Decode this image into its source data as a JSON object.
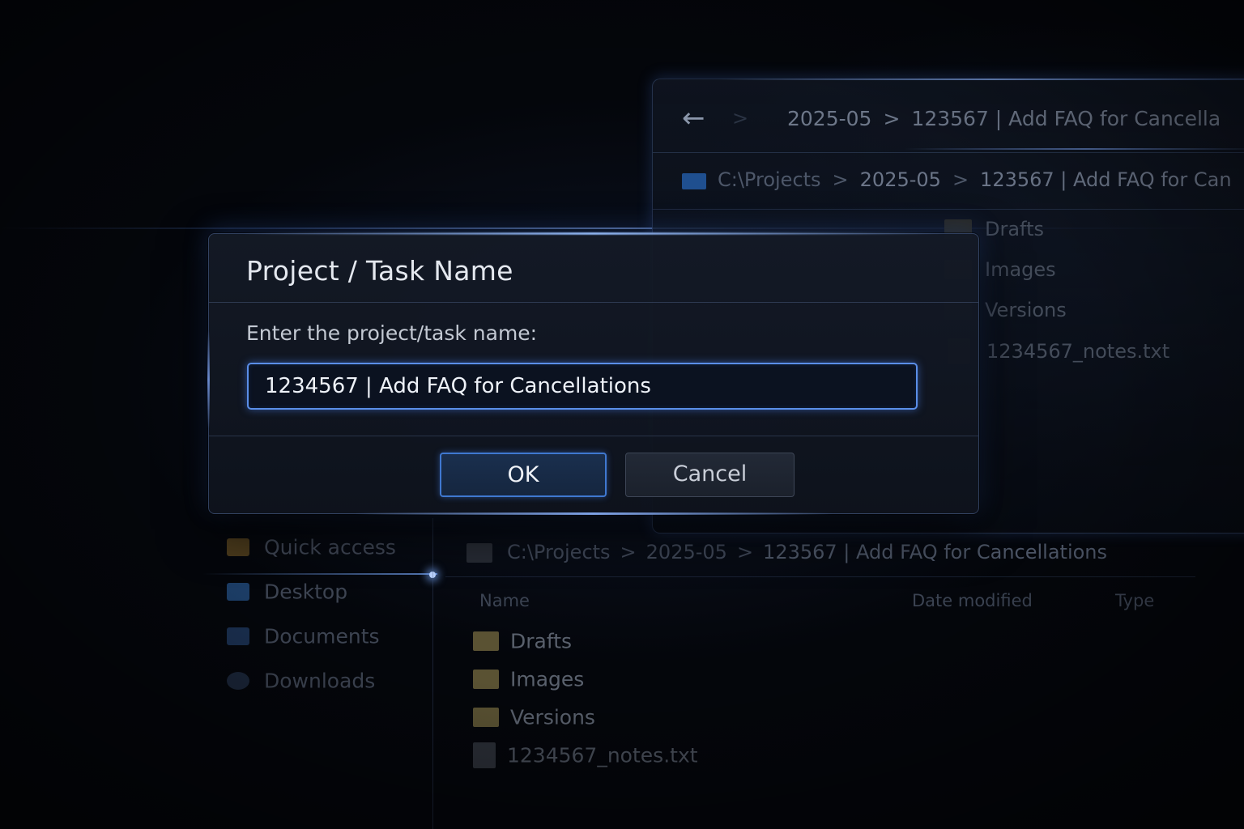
{
  "background_explorer_top": {
    "nav_breadcrumb": [
      "2025-05",
      "123567 | Add FAQ for Cancella"
    ],
    "address_path": [
      "C:\\Projects",
      "2025-05",
      "123567 | Add FAQ for Can"
    ],
    "items": [
      {
        "name": "Drafts",
        "icon": "folder-icon"
      },
      {
        "name": "Images",
        "icon": "folder-icon"
      },
      {
        "name": "Versions",
        "icon": "folder-icon"
      },
      {
        "name": "1234567_notes.txt",
        "icon": "text-file-icon"
      }
    ]
  },
  "background_explorer_bottom": {
    "sidebar": [
      {
        "label": "Quick access",
        "icon": "quick-access-icon",
        "color": "#4a3a1c"
      },
      {
        "label": "Desktop",
        "icon": "desktop-icon",
        "color": "#1c3d66"
      },
      {
        "label": "Documents",
        "icon": "documents-icon",
        "color": "#1a2f4f"
      },
      {
        "label": "Downloads",
        "icon": "downloads-icon",
        "color": "#1a2538"
      }
    ],
    "address_path": [
      "C:\\Projects",
      "2025-05",
      "123567 | Add FAQ for Cancellations"
    ],
    "columns": {
      "name": "Name",
      "date_modified": "Date modified",
      "type": "Type"
    },
    "files": [
      {
        "name": "Drafts",
        "icon": "folder-icon"
      },
      {
        "name": "Images",
        "icon": "folder-icon"
      },
      {
        "name": "Versions",
        "icon": "folder-icon"
      },
      {
        "name": "1234567_notes.txt",
        "icon": "text-file-icon"
      }
    ]
  },
  "dialog": {
    "title": "Project / Task Name",
    "prompt": "Enter the project/task name:",
    "input_value": "1234567 | Add FAQ for Cancellations",
    "ok_label": "OK",
    "cancel_label": "Cancel",
    "accent_color": "#5a8ee8"
  },
  "icons": {
    "back": "←",
    "chevron": ">"
  }
}
